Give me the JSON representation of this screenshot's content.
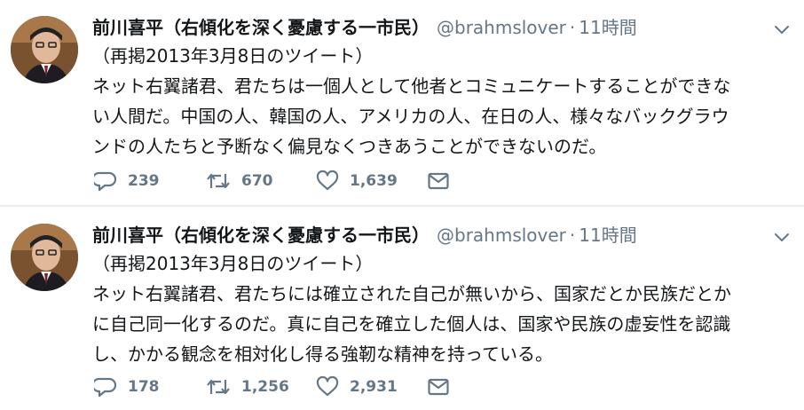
{
  "tweets": [
    {
      "author_name": "前川喜平（右傾化を深く憂慮する一市民）",
      "handle": "@brahmslover",
      "separator": "·",
      "time": "11時間",
      "lines": [
        "（再掲2013年3月8日のツイート）",
        "ネット右翼諸君、君たちは一個人として他者とコミュニケートすることができな",
        "い人間だ。中国の人、韓国の人、アメリカの人、在日の人、様々なバックグラウ",
        "ンドの人たちと予断なく偏見なくつきあうことができないのだ。"
      ],
      "replies": "239",
      "retweets": "670",
      "likes": "1,639"
    },
    {
      "author_name": "前川喜平（右傾化を深く憂慮する一市民）",
      "handle": "@brahmslover",
      "separator": "·",
      "time": "11時間",
      "lines": [
        "（再掲2013年3月8日のツイート）",
        "ネット右翼諸君、君たちには確立された自己が無いから、国家だとか民族だとか",
        "に自己同一化するのだ。真に自己を確立した個人は、国家や民族の虚妄性を認識",
        "し、かかる観念を相対化し得る強靭な精神を持っている。"
      ],
      "replies": "178",
      "retweets": "1,256",
      "likes": "2,931"
    }
  ],
  "icons": {
    "reply": "reply-icon",
    "retweet": "retweet-icon",
    "like": "heart-icon",
    "dm": "envelope-icon",
    "menu": "chevron-down-icon"
  },
  "colors": {
    "text": "#14171a",
    "muted": "#657786",
    "divider": "#e6ecf0"
  }
}
